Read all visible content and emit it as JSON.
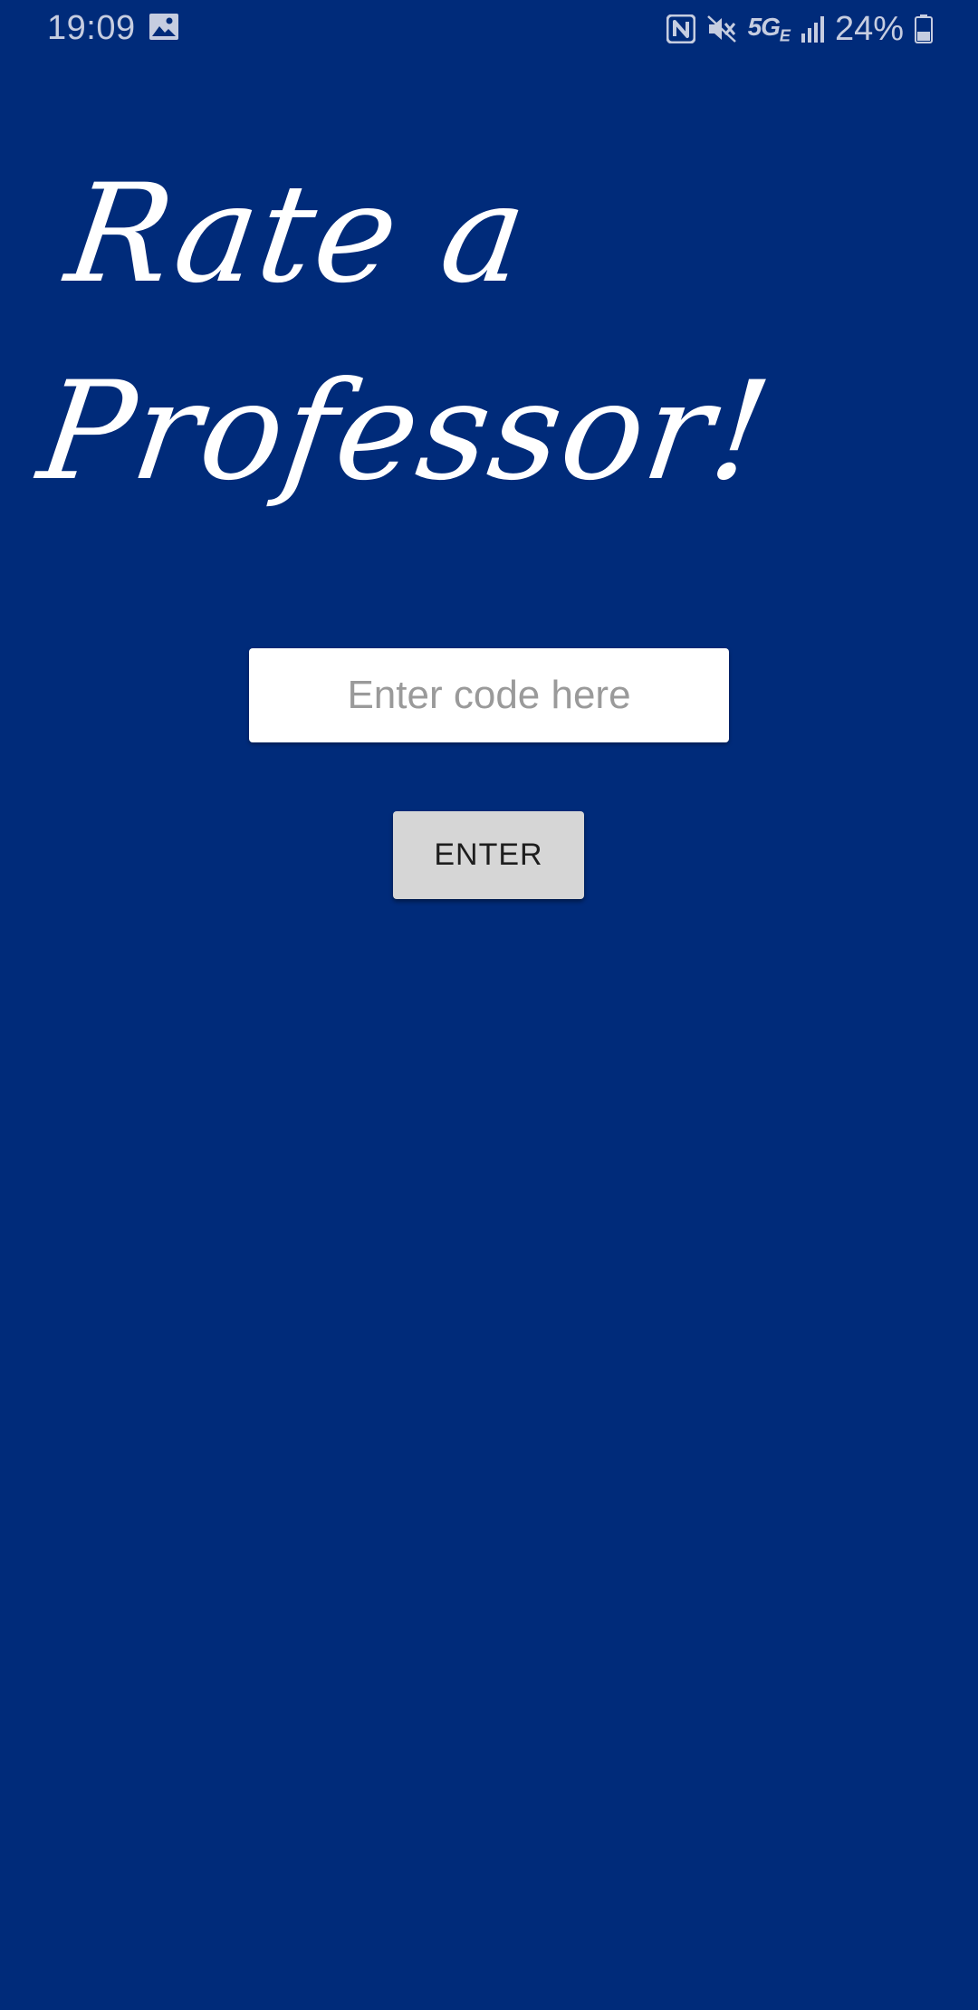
{
  "status_bar": {
    "time": "19:09",
    "network_type": "5G",
    "network_suffix": "E",
    "battery_percent": "24%",
    "icons": [
      "gallery-icon",
      "nfc-icon",
      "vibrate-mute-icon",
      "signal-icon",
      "battery-icon"
    ]
  },
  "title": {
    "line1": "Rate a",
    "line2": "Professor!"
  },
  "code_input": {
    "value": "",
    "placeholder": "Enter code here"
  },
  "enter_button": {
    "label": "ENTER"
  },
  "colors": {
    "background": "#002b7a",
    "title_text": "#ffffff",
    "input_background": "#ffffff",
    "button_background": "#d6d6d6",
    "status_text": "#c6cde0"
  }
}
